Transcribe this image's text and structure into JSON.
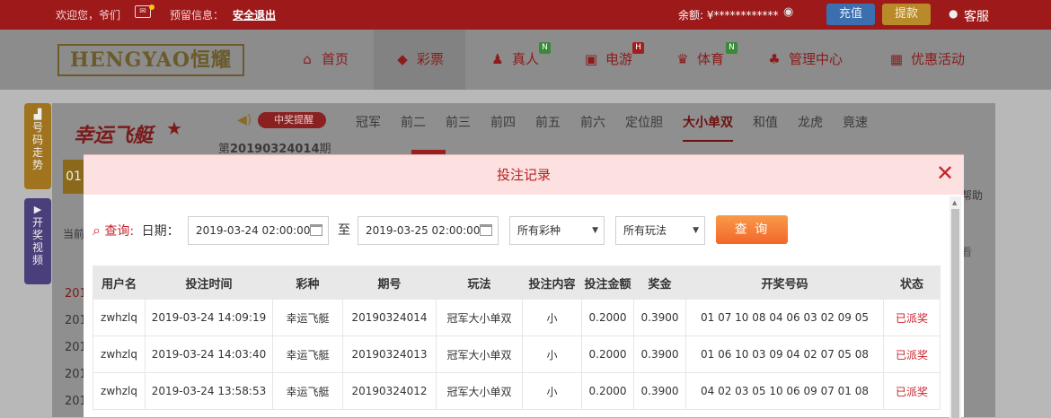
{
  "topbar": {
    "welcome": "欢迎您，爷们",
    "notice_label": "预留信息：",
    "logout": "安全退出",
    "balance_label": "余额: ¥************",
    "deposit": "充值",
    "withdraw": "提款",
    "service": "客服"
  },
  "nav": {
    "logo": "HENGYAO恒耀",
    "items": [
      {
        "label": "首页",
        "icon": "home-icon",
        "badge": ""
      },
      {
        "label": "彩票",
        "icon": "ticket-icon",
        "badge": ""
      },
      {
        "label": "真人",
        "icon": "person-icon",
        "badge": "N"
      },
      {
        "label": "电游",
        "icon": "slot-machine-icon",
        "badge": "H"
      },
      {
        "label": "体育",
        "icon": "trophy-icon",
        "badge": "N"
      },
      {
        "label": "管理中心",
        "icon": "users-icon",
        "badge": ""
      },
      {
        "label": "优惠活动",
        "icon": "gift-icon",
        "badge": ""
      }
    ]
  },
  "side": {
    "trend": "号码走势",
    "video": "开奖视频"
  },
  "game": {
    "title": "幸运飞艇",
    "sound_toggle": "中奖提醒",
    "period_prefix": "第",
    "period": "20190324014",
    "period_suffix": "期",
    "help": "帮助",
    "current": "当前",
    "tabs": [
      "冠军",
      "前二",
      "前三",
      "前四",
      "前五",
      "前六",
      "定位胆",
      "大小单双",
      "和值",
      "龙虎",
      "竟速"
    ],
    "active_tab": "大小单双",
    "bg_rows": [
      "201",
      "201",
      "201",
      "201",
      "201"
    ],
    "bg_badge": "01"
  },
  "modal": {
    "title": "投注记录",
    "query_label": "查询:",
    "date_label": "日期：",
    "date_from": "2019-03-24 02:00:00",
    "to": "至",
    "date_to": "2019-03-25 02:00:00",
    "lottery_select": "所有彩种",
    "play_select": "所有玩法",
    "query_button": "查 询"
  },
  "table": {
    "headers": [
      "用户名",
      "投注时间",
      "彩种",
      "期号",
      "玩法",
      "投注内容",
      "投注金额",
      "奖金",
      "开奖号码",
      "状态"
    ],
    "rows": [
      [
        "zwhzlq",
        "2019-03-24 14:09:19",
        "幸运飞艇",
        "20190324014",
        "冠军大小单双",
        "小",
        "0.2000",
        "0.3900",
        "01 07 10 08 04 06 03 02 09 05",
        "已派奖"
      ],
      [
        "zwhzlq",
        "2019-03-24 14:03:40",
        "幸运飞艇",
        "20190324013",
        "冠军大小单双",
        "小",
        "0.2000",
        "0.3900",
        "01 06 10 03 09 04 02 07 05 08",
        "已派奖"
      ],
      [
        "zwhzlq",
        "2019-03-24 13:58:53",
        "幸运飞艇",
        "20190324012",
        "冠军大小单双",
        "小",
        "0.2000",
        "0.3900",
        "04 02 03 05 10 06 09 07 01 08",
        "已派奖"
      ]
    ]
  }
}
